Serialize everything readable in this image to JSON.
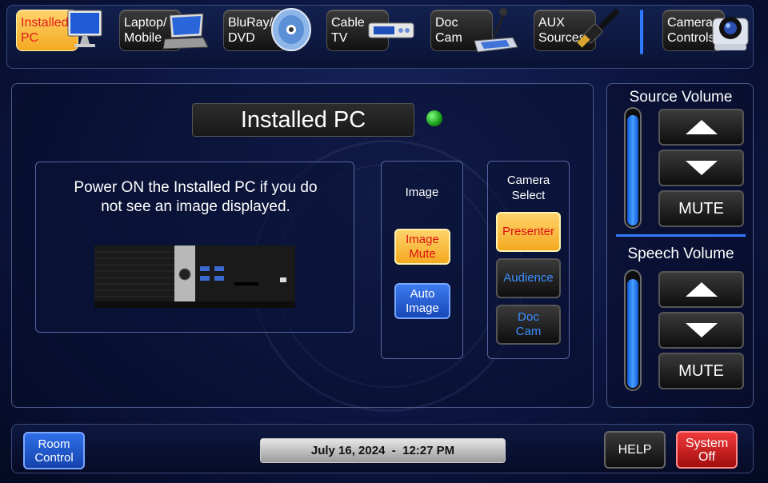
{
  "sources": [
    {
      "label": "Installed\nPC",
      "icon": "monitor-icon",
      "active": true
    },
    {
      "label": "Laptop/\nMobile",
      "icon": "laptop-icon",
      "active": false
    },
    {
      "label": "BluRay/\nDVD",
      "icon": "disc-icon",
      "active": false
    },
    {
      "label": "Cable\nTV",
      "icon": "cable-box-icon",
      "active": false
    },
    {
      "label": "Doc\nCam",
      "icon": "document-camera-icon",
      "active": false
    },
    {
      "label": "AUX\nSources",
      "icon": "hdmi-cable-icon",
      "active": false
    },
    {
      "label": "Camera\nControls",
      "icon": "ptz-camera-icon",
      "active": false
    }
  ],
  "main": {
    "title": "Installed PC",
    "instructions": "Power ON the Installed PC if you do not see an image displayed.",
    "image_group": {
      "title": "Image",
      "mute_label": "Image\nMute",
      "auto_label": "Auto\nImage"
    },
    "camera_group": {
      "title": "Camera\nSelect",
      "presenter_label": "Presenter",
      "audience_label": "Audience",
      "doccam_label": "Doc\nCam"
    }
  },
  "volume": {
    "source": {
      "title": "Source Volume",
      "mute_label": "MUTE",
      "level": 0.93
    },
    "speech": {
      "title": "Speech Volume",
      "mute_label": "MUTE",
      "level": 0.92
    }
  },
  "bottom": {
    "room_control_label": "Room\nControl",
    "datetime": "July 16, 2024  -  12:27 PM",
    "help_label": "HELP",
    "system_off_label": "System\nOff"
  },
  "colors": {
    "accent_blue": "#2f7bff",
    "active_yellow": "#f4a921",
    "status_green": "#1a9a1a",
    "off_red": "#d11"
  }
}
